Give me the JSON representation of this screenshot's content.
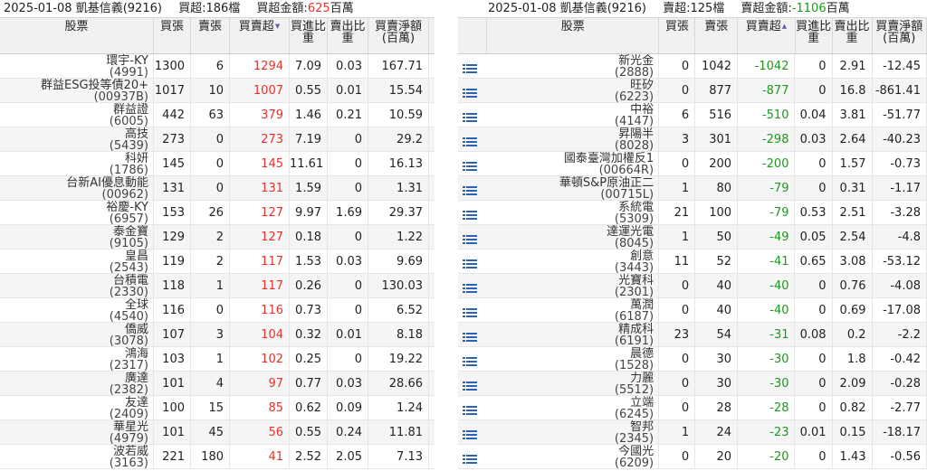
{
  "left": {
    "title": {
      "date": "2025-01-08",
      "broker": "凱基信義(9216)",
      "net_label": "買超:186檔",
      "amount_label": "買超金額:",
      "amount_value": "625",
      "amount_unit": "百萬"
    },
    "headers": {
      "stock": "股票",
      "buy": "買張",
      "sell": "賣張",
      "net": "買賣超",
      "buy_ratio": "買進比重",
      "sell_ratio": "賣出比重",
      "amount": "買賣淨額(百萬)"
    },
    "rows": [
      {
        "name": "環宇-KY",
        "code": "(4991)",
        "buy": "1300",
        "sell": "6",
        "net": "1294",
        "buy_ratio": "7.09",
        "sell_ratio": "0.03",
        "amount": "167.71"
      },
      {
        "name": "群益ESG投等債20+",
        "code": "(00937B)",
        "buy": "1017",
        "sell": "10",
        "net": "1007",
        "buy_ratio": "0.55",
        "sell_ratio": "0.01",
        "amount": "15.54"
      },
      {
        "name": "群益證",
        "code": "(6005)",
        "buy": "442",
        "sell": "63",
        "net": "379",
        "buy_ratio": "1.46",
        "sell_ratio": "0.21",
        "amount": "10.59"
      },
      {
        "name": "高技",
        "code": "(5439)",
        "buy": "273",
        "sell": "0",
        "net": "273",
        "buy_ratio": "7.19",
        "sell_ratio": "0",
        "amount": "29.2"
      },
      {
        "name": "科妍",
        "code": "(1786)",
        "buy": "145",
        "sell": "0",
        "net": "145",
        "buy_ratio": "11.61",
        "sell_ratio": "0",
        "amount": "16.13"
      },
      {
        "name": "台新AI優息動能",
        "code": "(00962)",
        "buy": "131",
        "sell": "0",
        "net": "131",
        "buy_ratio": "1.59",
        "sell_ratio": "0",
        "amount": "1.31"
      },
      {
        "name": "裕慶-KY",
        "code": "(6957)",
        "buy": "153",
        "sell": "26",
        "net": "127",
        "buy_ratio": "9.97",
        "sell_ratio": "1.69",
        "amount": "29.37"
      },
      {
        "name": "泰金寶",
        "code": "(9105)",
        "buy": "129",
        "sell": "2",
        "net": "127",
        "buy_ratio": "0.18",
        "sell_ratio": "0",
        "amount": "1.22"
      },
      {
        "name": "皇昌",
        "code": "(2543)",
        "buy": "119",
        "sell": "2",
        "net": "117",
        "buy_ratio": "1.53",
        "sell_ratio": "0.03",
        "amount": "9.69"
      },
      {
        "name": "台積電",
        "code": "(2330)",
        "buy": "118",
        "sell": "1",
        "net": "117",
        "buy_ratio": "0.26",
        "sell_ratio": "0",
        "amount": "130.03"
      },
      {
        "name": "全球",
        "code": "(4540)",
        "buy": "116",
        "sell": "0",
        "net": "116",
        "buy_ratio": "0.73",
        "sell_ratio": "0",
        "amount": "6.52"
      },
      {
        "name": "僑威",
        "code": "(3078)",
        "buy": "107",
        "sell": "3",
        "net": "104",
        "buy_ratio": "0.32",
        "sell_ratio": "0.01",
        "amount": "8.18"
      },
      {
        "name": "鴻海",
        "code": "(2317)",
        "buy": "103",
        "sell": "1",
        "net": "102",
        "buy_ratio": "0.25",
        "sell_ratio": "0",
        "amount": "19.22"
      },
      {
        "name": "廣達",
        "code": "(2382)",
        "buy": "101",
        "sell": "4",
        "net": "97",
        "buy_ratio": "0.77",
        "sell_ratio": "0.03",
        "amount": "28.66"
      },
      {
        "name": "友達",
        "code": "(2409)",
        "buy": "100",
        "sell": "15",
        "net": "85",
        "buy_ratio": "0.62",
        "sell_ratio": "0.09",
        "amount": "1.24"
      },
      {
        "name": "華星光",
        "code": "(4979)",
        "buy": "101",
        "sell": "45",
        "net": "56",
        "buy_ratio": "0.55",
        "sell_ratio": "0.24",
        "amount": "11.81"
      },
      {
        "name": "波若威",
        "code": "(3163)",
        "buy": "221",
        "sell": "180",
        "net": "41",
        "buy_ratio": "2.52",
        "sell_ratio": "2.05",
        "amount": "7.13"
      }
    ]
  },
  "right": {
    "title": {
      "date": "2025-01-08",
      "broker": "凱基信義(9216)",
      "net_label": "賣超:125檔",
      "amount_label": "賣超金額:",
      "amount_value": "-1106",
      "amount_unit": "百萬"
    },
    "headers": {
      "stock": "股票",
      "buy": "買張",
      "sell": "賣張",
      "net": "買賣超",
      "buy_ratio": "買進比重",
      "sell_ratio": "賣出比重",
      "amount": "買賣淨額(百萬)"
    },
    "rows": [
      {
        "name": "新光金",
        "code": "(2888)",
        "buy": "0",
        "sell": "1042",
        "net": "-1042",
        "buy_ratio": "0",
        "sell_ratio": "2.91",
        "amount": "-12.45"
      },
      {
        "name": "旺矽",
        "code": "(6223)",
        "buy": "0",
        "sell": "877",
        "net": "-877",
        "buy_ratio": "0",
        "sell_ratio": "16.8",
        "amount": "-861.41"
      },
      {
        "name": "中裕",
        "code": "(4147)",
        "buy": "6",
        "sell": "516",
        "net": "-510",
        "buy_ratio": "0.04",
        "sell_ratio": "3.81",
        "amount": "-51.77"
      },
      {
        "name": "昇陽半",
        "code": "(8028)",
        "buy": "3",
        "sell": "301",
        "net": "-298",
        "buy_ratio": "0.03",
        "sell_ratio": "2.64",
        "amount": "-40.23"
      },
      {
        "name": "國泰臺灣加權反1",
        "code": "(00664R)",
        "buy": "0",
        "sell": "200",
        "net": "-200",
        "buy_ratio": "0",
        "sell_ratio": "1.57",
        "amount": "-0.73"
      },
      {
        "name": "華頓S&P原油正二",
        "code": "(00715L)",
        "buy": "1",
        "sell": "80",
        "net": "-79",
        "buy_ratio": "0",
        "sell_ratio": "0.31",
        "amount": "-1.17"
      },
      {
        "name": "系統電",
        "code": "(5309)",
        "buy": "21",
        "sell": "100",
        "net": "-79",
        "buy_ratio": "0.53",
        "sell_ratio": "2.51",
        "amount": "-3.28"
      },
      {
        "name": "達運光電",
        "code": "(8045)",
        "buy": "1",
        "sell": "50",
        "net": "-49",
        "buy_ratio": "0.05",
        "sell_ratio": "2.54",
        "amount": "-4.8"
      },
      {
        "name": "創意",
        "code": "(3443)",
        "buy": "11",
        "sell": "52",
        "net": "-41",
        "buy_ratio": "0.65",
        "sell_ratio": "3.08",
        "amount": "-53.12"
      },
      {
        "name": "光寶科",
        "code": "(2301)",
        "buy": "0",
        "sell": "40",
        "net": "-40",
        "buy_ratio": "0",
        "sell_ratio": "0.76",
        "amount": "-4.08"
      },
      {
        "name": "萬潤",
        "code": "(6187)",
        "buy": "0",
        "sell": "40",
        "net": "-40",
        "buy_ratio": "0",
        "sell_ratio": "0.69",
        "amount": "-17.08"
      },
      {
        "name": "精成科",
        "code": "(6191)",
        "buy": "23",
        "sell": "54",
        "net": "-31",
        "buy_ratio": "0.08",
        "sell_ratio": "0.2",
        "amount": "-2.2"
      },
      {
        "name": "晨德",
        "code": "(1528)",
        "buy": "0",
        "sell": "30",
        "net": "-30",
        "buy_ratio": "0",
        "sell_ratio": "1.8",
        "amount": "-0.42"
      },
      {
        "name": "力麗",
        "code": "(5512)",
        "buy": "0",
        "sell": "30",
        "net": "-30",
        "buy_ratio": "0",
        "sell_ratio": "2.09",
        "amount": "-0.28"
      },
      {
        "name": "立端",
        "code": "(6245)",
        "buy": "0",
        "sell": "28",
        "net": "-28",
        "buy_ratio": "0",
        "sell_ratio": "0.82",
        "amount": "-2.77"
      },
      {
        "name": "智邦",
        "code": "(2345)",
        "buy": "1",
        "sell": "24",
        "net": "-23",
        "buy_ratio": "0.01",
        "sell_ratio": "0.15",
        "amount": "-18.17"
      },
      {
        "name": "今國光",
        "code": "(6209)",
        "buy": "0",
        "sell": "20",
        "net": "-20",
        "buy_ratio": "0",
        "sell_ratio": "1.43",
        "amount": "-0.56"
      }
    ]
  },
  "icons": {
    "row_menu": "menu-list-icon",
    "sort_desc": "sort-down-icon",
    "sort_asc": "sort-up-icon"
  },
  "colors": {
    "positive": "#e0332f",
    "negative": "#1a9a1a",
    "icon": "#2a63b8"
  }
}
